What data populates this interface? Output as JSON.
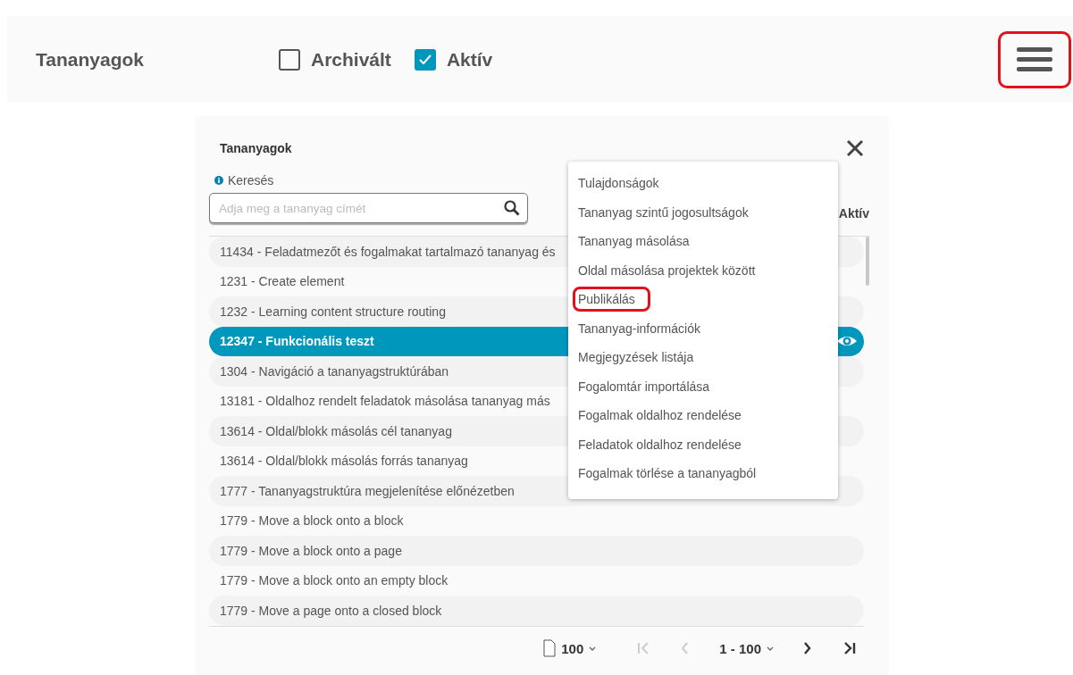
{
  "header": {
    "title": "Tananyagok",
    "filters": [
      {
        "label": "Archivált",
        "checked": false
      },
      {
        "label": "Aktív",
        "checked": true
      }
    ],
    "menu_button": {
      "highlighted": true
    }
  },
  "dialog": {
    "title": "Tananyagok",
    "search": {
      "label": "Keresés",
      "placeholder": "Adja meg a tananyag címét"
    },
    "column_header": "Aktív",
    "rows": [
      {
        "text": "11434 - Feladatmezőt és fogalmakat tartalmazó tananyag és",
        "selected": false
      },
      {
        "text": "1231 - Create element",
        "selected": false
      },
      {
        "text": "1232 - Learning content structure routing",
        "selected": false
      },
      {
        "text": "12347 - Funkcionális teszt",
        "selected": true
      },
      {
        "text": "1304 - Navigáció a tananyagstruktúrában",
        "selected": false
      },
      {
        "text": "13181 - Oldalhoz rendelt feladatok másolása tananyag más",
        "selected": false
      },
      {
        "text": "13614 - Oldal/blokk másolás cél tananyag",
        "selected": false
      },
      {
        "text": "13614 - Oldal/blokk másolás forrás tananyag",
        "selected": false
      },
      {
        "text": "1777 - Tananyagstruktúra megjelenítése előnézetben",
        "selected": false
      },
      {
        "text": "1779 - Move a block onto a block",
        "selected": false
      },
      {
        "text": "1779 - Move a block onto a page",
        "selected": false
      },
      {
        "text": "1779 - Move a block onto an empty block",
        "selected": false
      },
      {
        "text": "1779 - Move a page onto a closed block",
        "selected": false
      }
    ],
    "pagination": {
      "page_size": "100",
      "range": "1 - 100",
      "buttons": [
        {
          "kind": "first",
          "disabled": true
        },
        {
          "kind": "prev",
          "disabled": true
        },
        {
          "kind": "next",
          "disabled": false
        },
        {
          "kind": "last",
          "disabled": false
        }
      ]
    }
  },
  "menu": {
    "items": [
      {
        "label": "Tulajdonságok",
        "highlighted": false
      },
      {
        "label": "Tananyag szintű jogosultságok",
        "highlighted": false
      },
      {
        "label": "Tananyag másolása",
        "highlighted": false
      },
      {
        "label": "Oldal másolása projektek között",
        "highlighted": false
      },
      {
        "label": "Publikálás",
        "highlighted": true
      },
      {
        "label": "Tananyag-információk",
        "highlighted": false
      },
      {
        "label": "Megjegyzések listája",
        "highlighted": false
      },
      {
        "label": "Fogalomtár importálása",
        "highlighted": false
      },
      {
        "label": "Fogalmak oldalhoz rendelése",
        "highlighted": false
      },
      {
        "label": "Feladatok oldalhoz rendelése",
        "highlighted": false
      },
      {
        "label": "Fogalmak törlése a tananyagból",
        "highlighted": false
      }
    ]
  }
}
